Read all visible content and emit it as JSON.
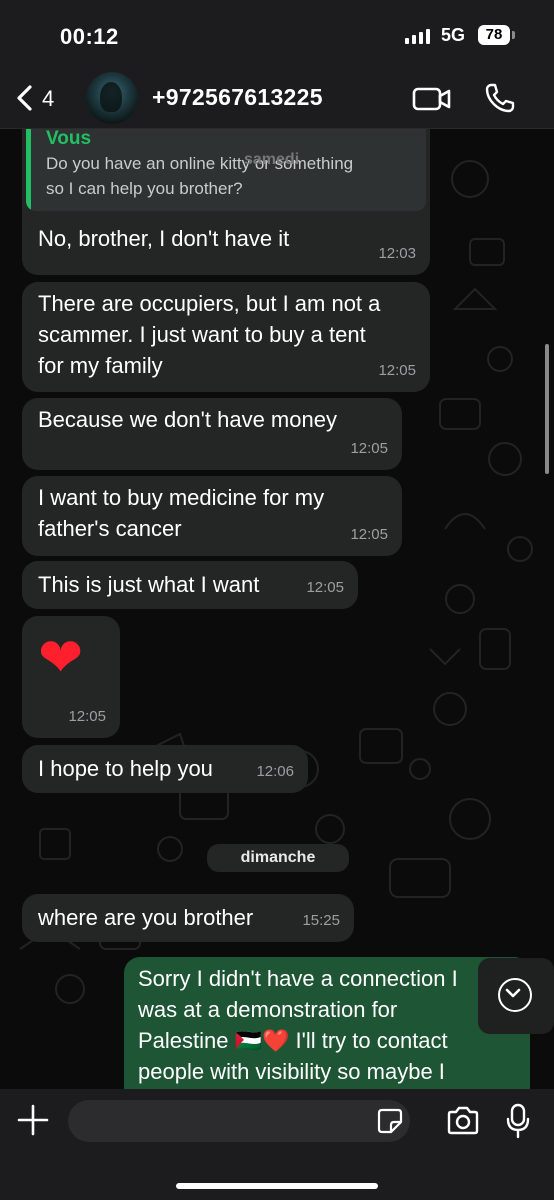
{
  "status_bar": {
    "time": "00:12",
    "network": "5G",
    "battery": "78"
  },
  "header": {
    "back_count": "4",
    "contact_name": "+972567613225",
    "icons": [
      "chevron-left-icon",
      "video-icon",
      "phone-icon"
    ]
  },
  "chat": {
    "messages": [
      {
        "quote_name": "Vous",
        "quote_text": "Do you have an online kitty or something\nso I can help you brother?",
        "text": "No, brother, I don't have it",
        "time": "12:03"
      },
      {
        "text": "There are occupiers, but I am not a\nscammer. I just want to buy a tent\nfor my family",
        "time": "12:05"
      },
      {
        "text": "Because we don't have money",
        "time": "12:05"
      },
      {
        "text": "I want to buy medicine for my\nfather's cancer",
        "time": "12:05"
      },
      {
        "text": "This is just what I want",
        "time": "12:05"
      },
      {
        "emoji": "❤",
        "time": "12:05"
      },
      {
        "text": "I hope to help you",
        "time": "12:06"
      },
      {
        "text": "where are you brother",
        "time": "15:25"
      },
      {
        "text": "Sorry I didn't have a connection I\nwas at a demonstration for\nPalestine 🇵🇸❤️ I'll try to contact\npeople with visibility so maybe I"
      }
    ],
    "day_labels": {
      "samedi": "samedi",
      "dimanche": "dimanche"
    }
  },
  "input_bar": {
    "placeholder": ""
  },
  "colors": {
    "incoming_bubble": "#242626",
    "outgoing_bubble": "#1e5535",
    "accent_green": "#21c064",
    "background": "#0b0b0b"
  }
}
